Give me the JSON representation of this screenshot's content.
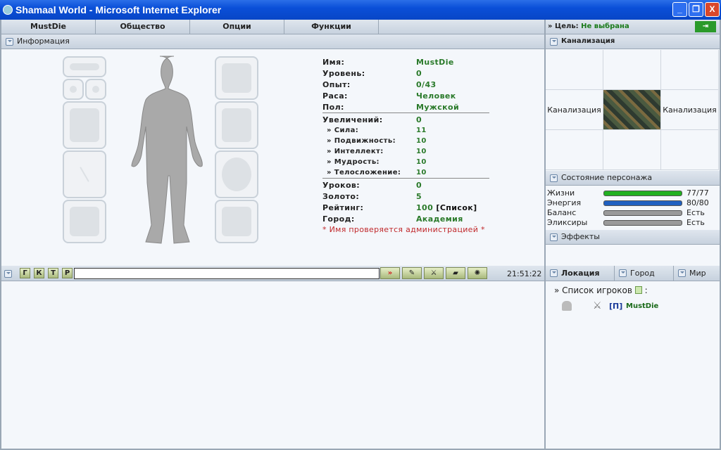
{
  "window": {
    "title": "Shamaal World - Microsoft Internet Explorer",
    "minimize": "_",
    "restore": "❐",
    "close": "X"
  },
  "menu": [
    "MustDie",
    "Общество",
    "Опции",
    "Функции"
  ],
  "target": {
    "prefix": "» Цель:",
    "value": "Не выбрана",
    "exit_icon": "exit-door-icon"
  },
  "info_header": "Информация",
  "character": {
    "rows": [
      {
        "k": "Имя:",
        "v": "MustDie"
      },
      {
        "k": "Уровень:",
        "v": "0"
      },
      {
        "k": "Опыт:",
        "v": "0/43"
      },
      {
        "k": "Раса:",
        "v": "Человек"
      },
      {
        "k": "Пол:",
        "v": "Мужской"
      },
      {
        "k": "Увеличений:",
        "v": "0"
      },
      {
        "k": "» Сила:",
        "v": "11"
      },
      {
        "k": "» Подвижность:",
        "v": "10"
      },
      {
        "k": "» Интеллект:",
        "v": "10"
      },
      {
        "k": "» Мудрость:",
        "v": "10"
      },
      {
        "k": "» Телосложение:",
        "v": "10"
      },
      {
        "k": "Уроков:",
        "v": "0"
      },
      {
        "k": "Золото:",
        "v": "5"
      },
      {
        "k": "Рейтинг:",
        "v": "100",
        "link": "[Список]"
      },
      {
        "k": "Город:",
        "v": "Академия"
      }
    ],
    "notice": "* Имя проверяется администрацией *"
  },
  "location": {
    "header": "Канализация",
    "west": "Канализация",
    "east": "Канализация"
  },
  "state": {
    "header": "Состояние персонажа",
    "stats": [
      {
        "k": "Жизни",
        "v": "77/77",
        "fill": 1.0,
        "color": "#22b022"
      },
      {
        "k": "Энергия",
        "v": "80/80",
        "fill": 1.0,
        "color": "#2060c0"
      },
      {
        "k": "Баланс",
        "v": "Есть",
        "fill": 1.0,
        "color": "#9a9a9a"
      },
      {
        "k": "Эликсиры",
        "v": "Есть",
        "fill": 1.0,
        "color": "#9a9a9a"
      }
    ]
  },
  "effects_header": "Эффекты",
  "chat": {
    "channels": [
      "Г",
      "К",
      "Т",
      "Р"
    ],
    "input": "",
    "send": "»",
    "time": "21:51:22"
  },
  "tabs": [
    "Локация",
    "Город",
    "Мир"
  ],
  "players": {
    "title": "» Список игроков",
    "colon": ":",
    "list": [
      {
        "tag": "[П]",
        "name": "MustDie"
      }
    ]
  }
}
